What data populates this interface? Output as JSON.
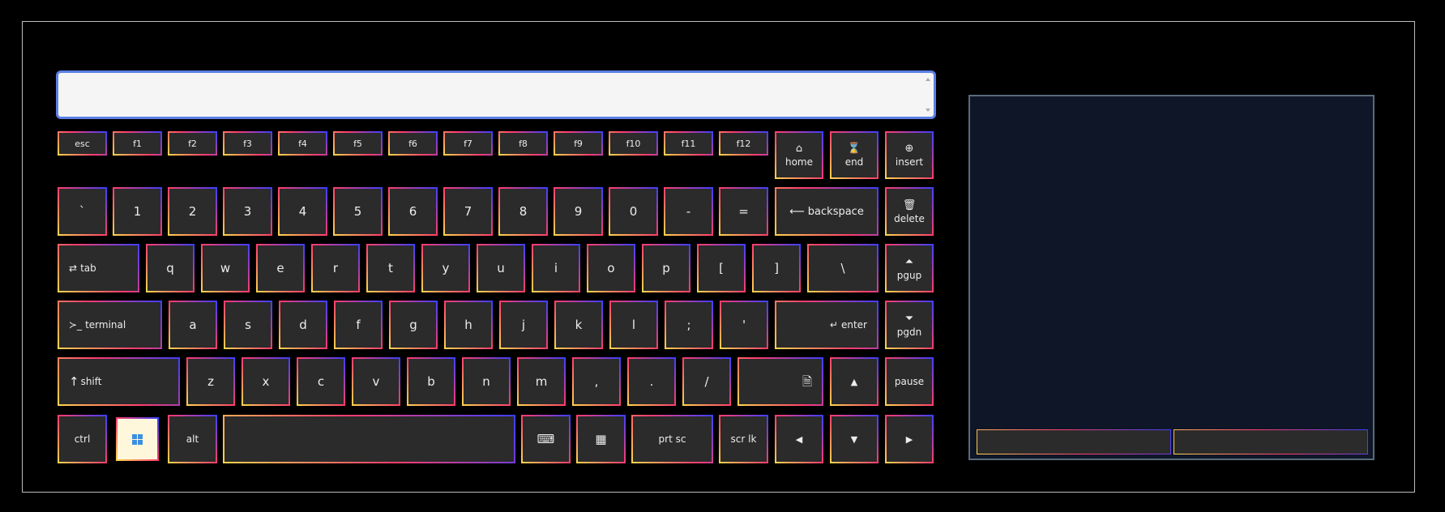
{
  "input": {
    "value": "",
    "placeholder": ""
  },
  "keys": {
    "row0": [
      "esc",
      "f1",
      "f2",
      "f3",
      "f4",
      "f5",
      "f6",
      "f7",
      "f8",
      "f9",
      "f10",
      "f11",
      "f12"
    ],
    "home": "home",
    "end": "end",
    "insert": "insert",
    "row1": [
      "`",
      "1",
      "2",
      "3",
      "4",
      "5",
      "6",
      "7",
      "8",
      "9",
      "0",
      "-",
      "="
    ],
    "backspace": "backspace",
    "delete": "delete",
    "tab": "tab",
    "row2": [
      "q",
      "w",
      "e",
      "r",
      "t",
      "y",
      "u",
      "i",
      "o",
      "p",
      "[",
      "]",
      "\\"
    ],
    "pgup": "pgup",
    "terminal": "terminal",
    "row3": [
      "a",
      "s",
      "d",
      "f",
      "g",
      "h",
      "j",
      "k",
      "l",
      ";",
      "'"
    ],
    "enter": "enter",
    "pgdn": "pgdn",
    "shift": "shift",
    "row4": [
      "z",
      "x",
      "c",
      "v",
      "b",
      "n",
      "m",
      ",",
      ".",
      "/"
    ],
    "pause": "pause",
    "ctrl": "ctrl",
    "alt": "alt",
    "prtsc": "prt sc",
    "scrlk": "scr lk"
  },
  "icons": {
    "home": "⌂",
    "end": "⌛",
    "insert": "⊕",
    "backspace": "⟵",
    "delete": "🗑",
    "tab": "⇄",
    "pgup": "⏶",
    "terminal": "≻_",
    "enter": "↵",
    "pgdn": "⏷",
    "shift": "↑",
    "doc": "🗎",
    "up": "▲",
    "left": "◀",
    "down": "▼",
    "right": "▶",
    "keyboard": "⌨",
    "calculator": "▦"
  },
  "colors": {
    "gradient_start": "#ffd54f",
    "gradient_mid": "#ff3d6e",
    "gradient_end": "#3e3fff",
    "accent_border": "#5b7fe6",
    "touchpad_bg": "#0f1628"
  }
}
